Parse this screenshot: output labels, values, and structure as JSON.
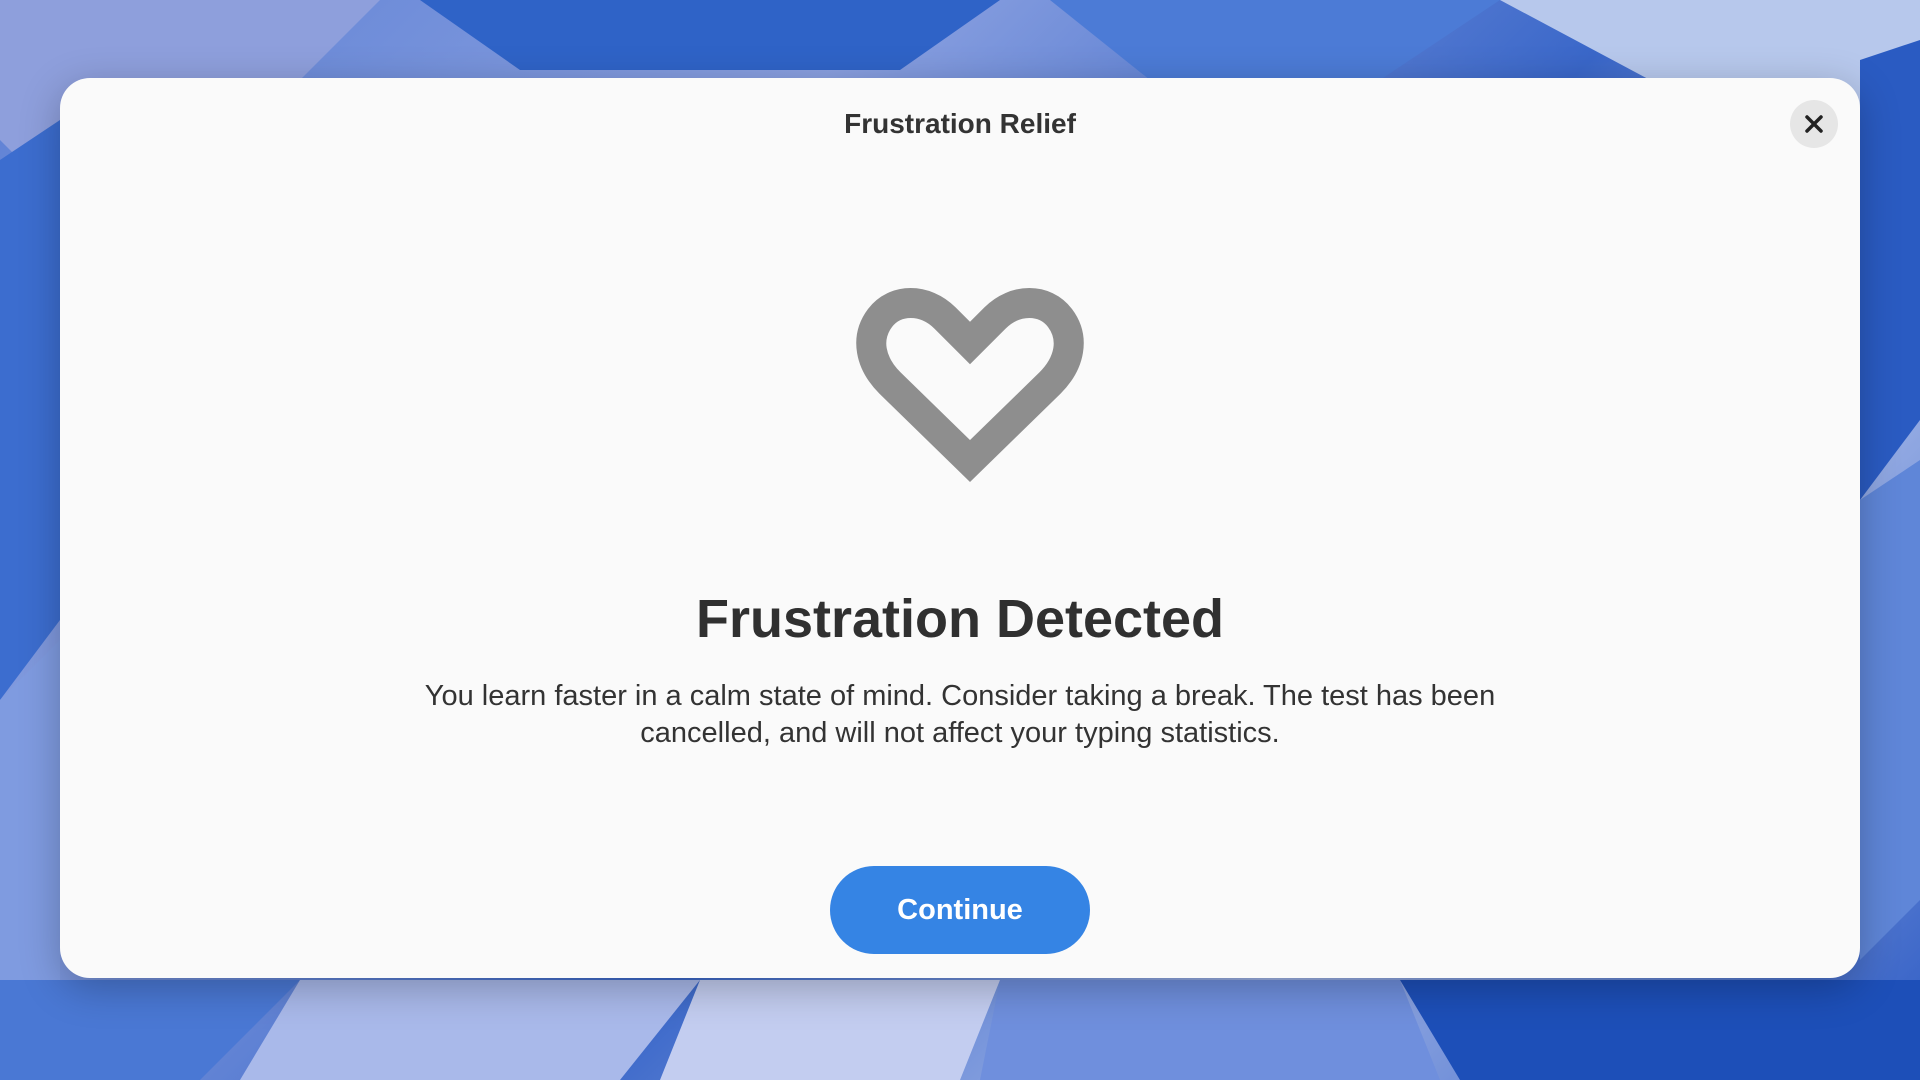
{
  "dialog": {
    "title": "Frustration Relief",
    "close_icon": "close-icon",
    "main_icon": "heart-icon",
    "headline": "Frustration Detected",
    "message": "You learn faster in a calm state of mind. Consider taking a break. The test has been cancelled, and will not affect your typing statistics.",
    "continue_label": "Continue"
  },
  "colors": {
    "accent": "#3584e4",
    "dialog_background": "#fafafa",
    "heart": "#8e8e8e",
    "text": "#333333"
  }
}
